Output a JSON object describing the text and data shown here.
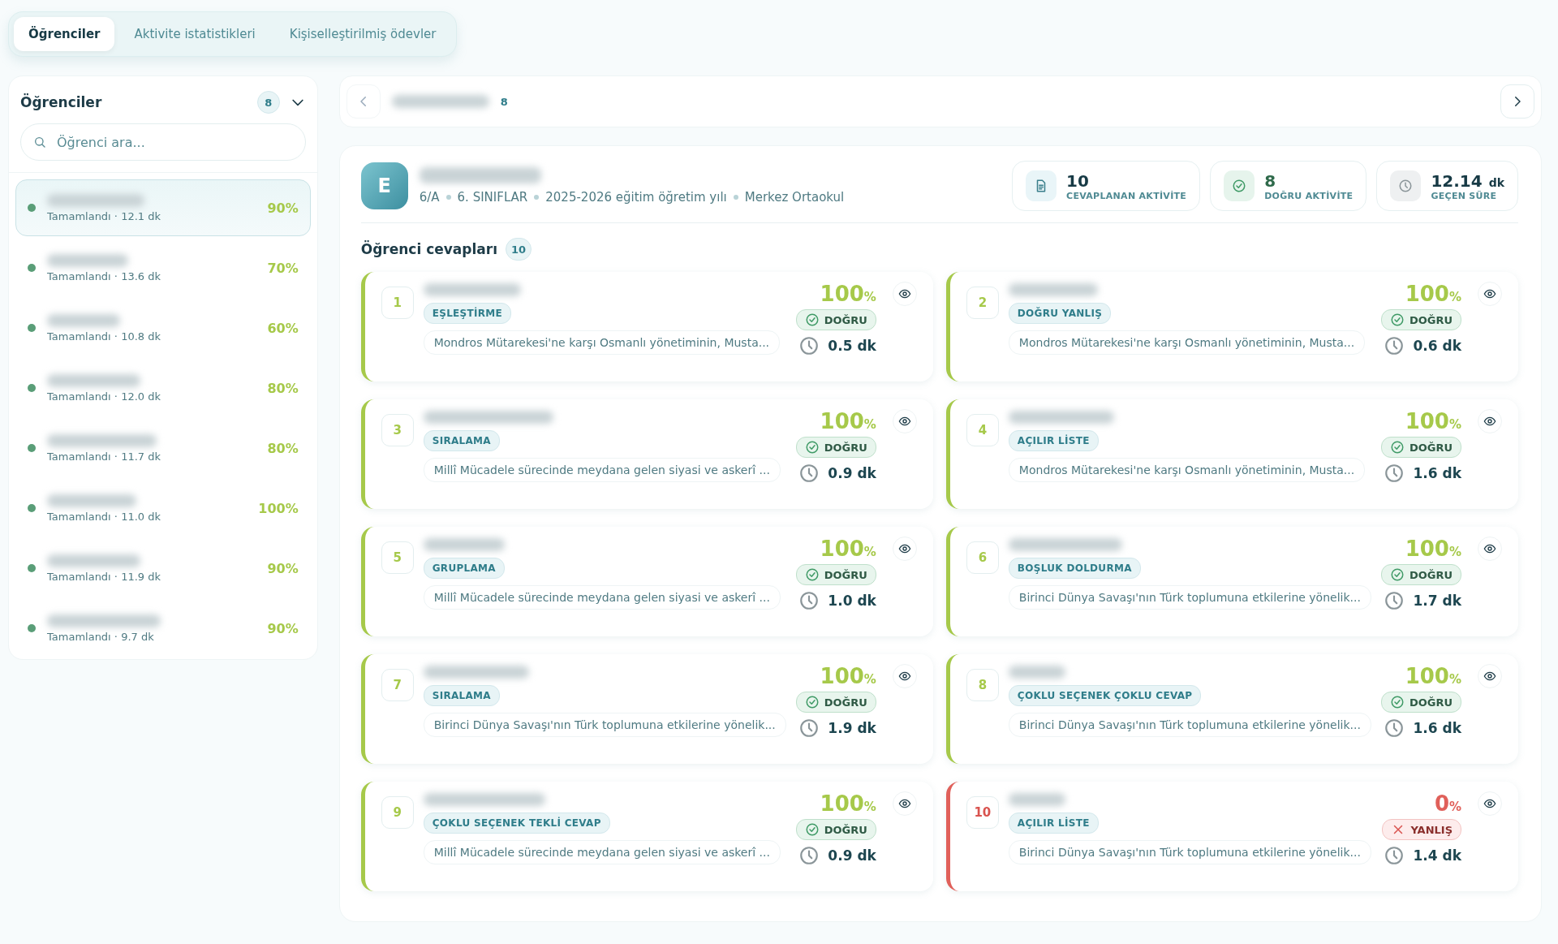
{
  "tabs": [
    {
      "label": "Öğrenciler",
      "selected": true
    },
    {
      "label": "Aktivite istatistikleri",
      "selected": false
    },
    {
      "label": "Kişiselleştirilmiş ödevler",
      "selected": false
    }
  ],
  "sidebar": {
    "title": "Öğrenciler",
    "count": "8",
    "search": {
      "placeholder": "Öğrenci ara..."
    },
    "students": [
      {
        "status": "Tamamlandı · 12.1 dk",
        "score": "90%",
        "selected": true,
        "color": "#5a9e78"
      },
      {
        "status": "Tamamlandı · 13.6 dk",
        "score": "70%",
        "selected": false,
        "color": "#5a9e78"
      },
      {
        "status": "Tamamlandı · 10.8 dk",
        "score": "60%",
        "selected": false,
        "color": "#5a9e78"
      },
      {
        "status": "Tamamlandı · 12.0 dk",
        "score": "80%",
        "selected": false,
        "color": "#5a9e78"
      },
      {
        "status": "Tamamlandı · 11.7 dk",
        "score": "80%",
        "selected": false,
        "color": "#5a9e78"
      },
      {
        "status": "Tamamlandı · 11.0 dk",
        "score": "100%",
        "selected": false,
        "color": "#5a9e78"
      },
      {
        "status": "Tamamlandı · 11.9 dk",
        "score": "90%",
        "selected": false,
        "color": "#5a9e78"
      },
      {
        "status": "Tamamlandı · 9.7 dk",
        "score": "90%",
        "selected": false,
        "color": "#5a9e78"
      }
    ]
  },
  "nav": {
    "count": "8"
  },
  "student": {
    "initial": "E",
    "meta": [
      "6/A",
      "6. SINIFLAR",
      "2025-2026 eğitim öğretim yılı",
      "Merkez Ortaokul"
    ],
    "stats": [
      {
        "kind": "doc",
        "value": "10",
        "label": "CEVAPLANAN AKTİVİTE"
      },
      {
        "kind": "check",
        "value": "8",
        "label": "DOĞRU AKTİVİTE"
      },
      {
        "kind": "clock",
        "value": "12.14",
        "unit": "dk",
        "label": "GEÇEN SÜRE"
      }
    ]
  },
  "answers": {
    "title": "Öğrenci cevapları",
    "count": "10",
    "items": [
      {
        "number": "1",
        "type": "EŞLEŞTİRME",
        "question": "Mondros Mütarekesi'ne karşı Osmanlı yönetiminin, Musta...",
        "score": "100",
        "unit": "%",
        "correct": true,
        "result": "DOĞRU",
        "time": "0.5 dk"
      },
      {
        "number": "2",
        "type": "DOĞRU YANLIŞ",
        "question": "Mondros Mütarekesi'ne karşı Osmanlı yönetiminin, Musta...",
        "score": "100",
        "unit": "%",
        "correct": true,
        "result": "DOĞRU",
        "time": "0.6 dk"
      },
      {
        "number": "3",
        "type": "SIRALAMA",
        "question": "Millî Mücadele sürecinde meydana gelen siyasi ve askerî ...",
        "score": "100",
        "unit": "%",
        "correct": true,
        "result": "DOĞRU",
        "time": "0.9 dk"
      },
      {
        "number": "4",
        "type": "AÇILIR LİSTE",
        "question": "Mondros Mütarekesi'ne karşı Osmanlı yönetiminin, Musta...",
        "score": "100",
        "unit": "%",
        "correct": true,
        "result": "DOĞRU",
        "time": "1.6 dk"
      },
      {
        "number": "5",
        "type": "GRUPLAMA",
        "question": "Millî Mücadele sürecinde meydana gelen siyasi ve askerî ...",
        "score": "100",
        "unit": "%",
        "correct": true,
        "result": "DOĞRU",
        "time": "1.0 dk"
      },
      {
        "number": "6",
        "type": "BOŞLUK DOLDURMA",
        "question": "Birinci Dünya Savaşı'nın Türk toplumuna etkilerine yönelik...",
        "score": "100",
        "unit": "%",
        "correct": true,
        "result": "DOĞRU",
        "time": "1.7 dk"
      },
      {
        "number": "7",
        "type": "SIRALAMA",
        "question": "Birinci Dünya Savaşı'nın Türk toplumuna etkilerine yönelik...",
        "score": "100",
        "unit": "%",
        "correct": true,
        "result": "DOĞRU",
        "time": "1.9 dk"
      },
      {
        "number": "8",
        "type": "ÇOKLU SEÇENEK ÇOKLU CEVAP",
        "question": "Birinci Dünya Savaşı'nın Türk toplumuna etkilerine yönelik...",
        "score": "100",
        "unit": "%",
        "correct": true,
        "result": "DOĞRU",
        "time": "1.6 dk"
      },
      {
        "number": "9",
        "type": "ÇOKLU SEÇENEK TEKLİ CEVAP",
        "question": "Millî Mücadele sürecinde meydana gelen siyasi ve askerî ...",
        "score": "100",
        "unit": "%",
        "correct": true,
        "result": "DOĞRU",
        "time": "0.9 dk"
      },
      {
        "number": "10",
        "type": "AÇILIR LİSTE",
        "question": "Birinci Dünya Savaşı'nın Türk toplumuna etkilerine yönelik...",
        "score": "0",
        "unit": "%",
        "correct": false,
        "result": "YANLIŞ",
        "time": "1.4 dk"
      }
    ]
  }
}
